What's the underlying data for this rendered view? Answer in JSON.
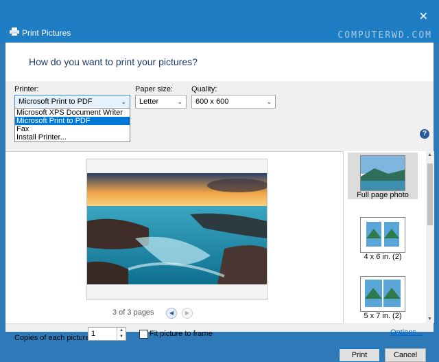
{
  "window": {
    "title": "Print Pictures",
    "watermark": "COMPUTERWD.COM"
  },
  "header": {
    "heading": "How do you want to print your pictures?"
  },
  "printer": {
    "label": "Printer:",
    "selected": "Microsoft Print to PDF",
    "options": [
      "Microsoft XPS Document Writer",
      "Microsoft Print to PDF",
      "Fax",
      "Install Printer..."
    ]
  },
  "paper": {
    "label": "Paper size:",
    "selected": "Letter"
  },
  "quality": {
    "label": "Quality:",
    "selected": "600 x 600"
  },
  "help": {
    "glyph": "?"
  },
  "preview": {
    "pages_text": "3 of 3 pages"
  },
  "layouts": [
    {
      "label": "Full page photo"
    },
    {
      "label": "4 x 6 in. (2)"
    },
    {
      "label": "5 x 7 in. (2)"
    }
  ],
  "footer": {
    "copies_label": "Copies of each picture:",
    "copies_value": "1",
    "fit_label": "Fit picture to frame",
    "options_link": "Options...",
    "print_button": "Print",
    "cancel_button": "Cancel"
  },
  "colors": {
    "accent": "#1f7dc4",
    "selection": "#0078d7"
  }
}
